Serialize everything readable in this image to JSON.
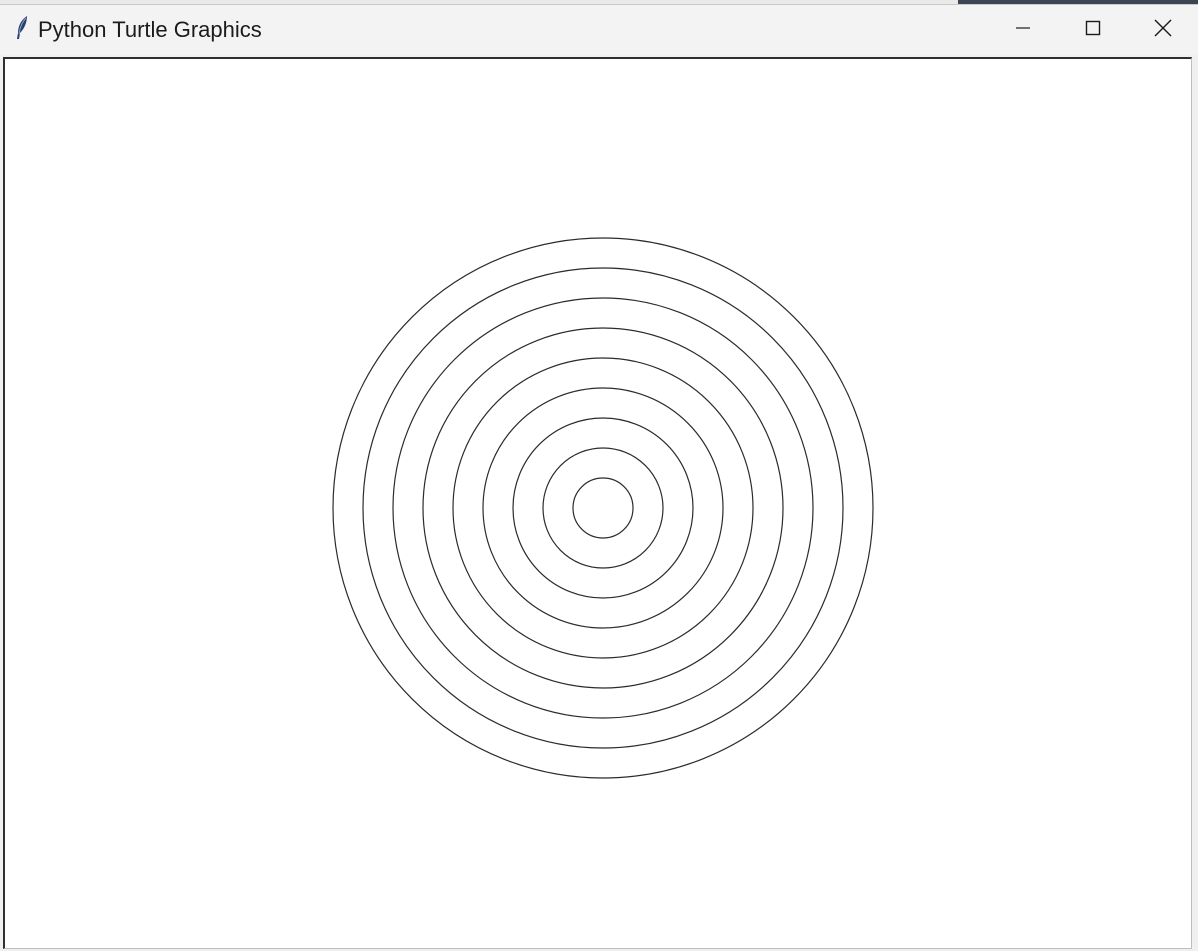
{
  "window": {
    "title": "Python Turtle Graphics",
    "app_icon": "feather-icon",
    "controls": {
      "minimize_icon": "minimize-icon",
      "maximize_icon": "maximize-icon",
      "close_icon": "close-icon"
    }
  },
  "canvas": {
    "background": "#ffffff",
    "stroke_color": "#2b2b2b",
    "circles": [
      {
        "radius": 30
      },
      {
        "radius": 60
      },
      {
        "radius": 90
      },
      {
        "radius": 120
      },
      {
        "radius": 150
      },
      {
        "radius": 180
      },
      {
        "radius": 210
      },
      {
        "radius": 240
      },
      {
        "radius": 270
      }
    ]
  }
}
